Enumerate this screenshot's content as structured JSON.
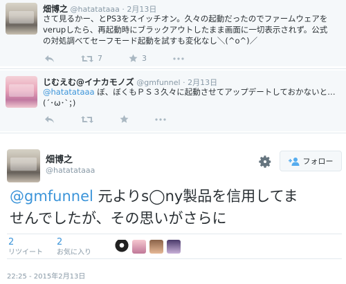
{
  "tweet1": {
    "name": "畑博之",
    "handle": "@hatatataaa",
    "dot": "·",
    "date": "2月13日",
    "text_lines": [
      "さて見るかー、とPS3をスイッチオン。久々の起動だったのでファームウェアを",
      "verupしたら、再起動時にブラックアウトしたまま画面に一切表示されず。公式",
      "の対処調べてセーフモード起動を試すも変化なし＼(^o^)／"
    ],
    "retweets": "7",
    "favorites": "3"
  },
  "tweet2": {
    "name": "じむえむ@イナカモノズ",
    "handle": "@gmfunnel",
    "dot": "·",
    "date": "2月13日",
    "mention": "@hatatataaa",
    "text_line1": " ぼ、ぼくもＰＳ３久々に起動させてアップデートしておかないと…",
    "text_line2": "(´･ω･`；)"
  },
  "main": {
    "name": "畑博之",
    "handle": "@hatatataaa",
    "follow_label": "フォロー",
    "mention": "@gmfunnel",
    "text_line1_rest": " 元よりs◯ny製品を信用してま",
    "text_line2": "せんでしたが、その思いがさらに",
    "retweet_count": "2",
    "retweet_label": "リツイート",
    "favorite_count": "2",
    "favorite_label": "お気に入り",
    "timestamp": "22:25 - 2015年2月13日"
  },
  "colors": {
    "link": "#3b94d9",
    "muted": "#8899a6",
    "icon": "#aab8c2"
  },
  "icons": [
    "reply-icon",
    "retweet-icon",
    "favorite-icon",
    "more-icon",
    "gear-icon",
    "follow-person-icon"
  ]
}
